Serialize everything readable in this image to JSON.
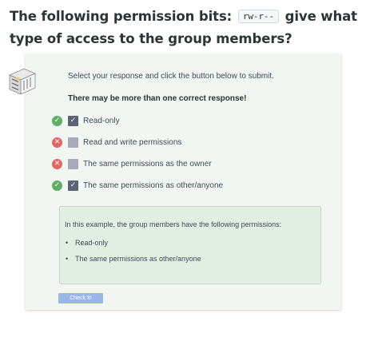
{
  "question": {
    "prefix": "The following permission bits:",
    "code": "rw-r--",
    "suffix": "give what type of access to the group members?"
  },
  "instructions": "Select your response and click the button below to submit.",
  "note": "There may be more than one correct response!",
  "options": [
    {
      "label": "Read-only",
      "result": "correct",
      "checked": true
    },
    {
      "label": "Read and write permissions",
      "result": "incorrect",
      "checked": false
    },
    {
      "label": "The same permissions as the owner",
      "result": "incorrect",
      "checked": false
    },
    {
      "label": "The same permissions as other/anyone",
      "result": "correct",
      "checked": true
    }
  ],
  "explanation": {
    "intro": "In this example, the group members have the following permissions:",
    "items": [
      "Read-only",
      "The same permissions as other/anyone"
    ]
  },
  "submit_label": "Check It!",
  "colors": {
    "correct": "#5fae63",
    "incorrect": "#e06763",
    "checked_box": "#5a6476",
    "unchecked_box": "#a9a9bb",
    "button": "#9ab6e8",
    "panel": "#f2f6f2",
    "explanation_bg": "#e3eee2"
  }
}
